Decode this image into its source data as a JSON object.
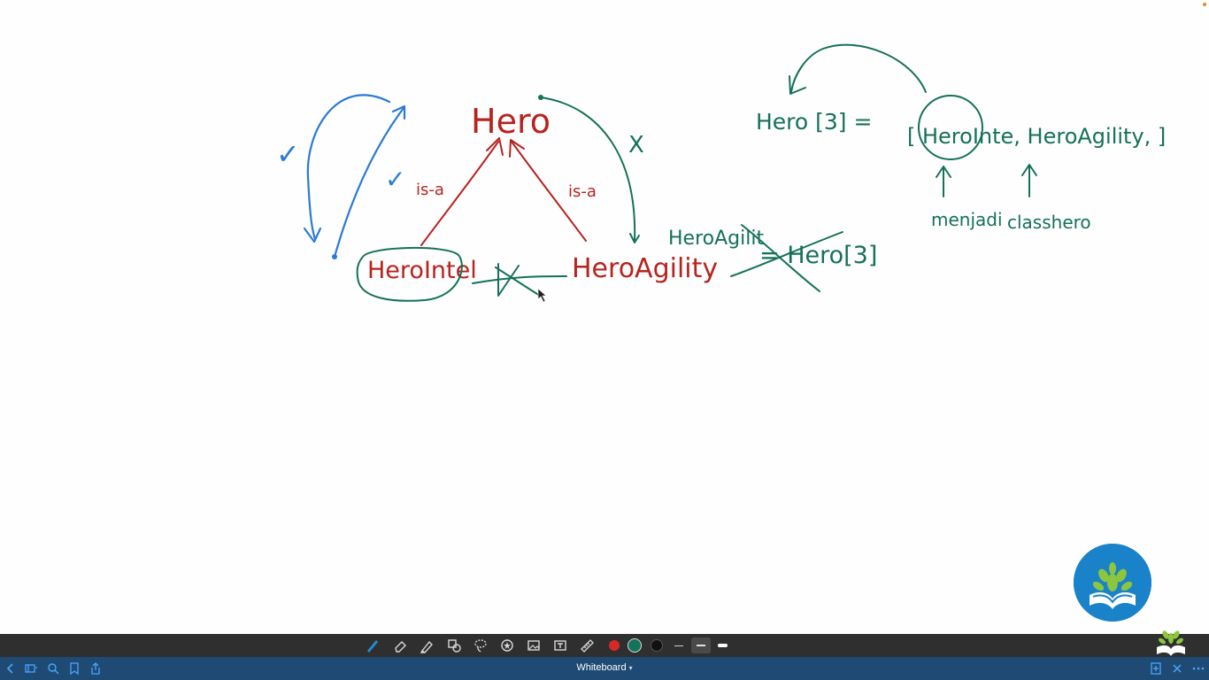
{
  "app": {
    "title": "Whiteboard"
  },
  "canvas": {
    "ink_colors": {
      "red": "#b8231f",
      "green": "#14715a",
      "blue": "#2a7ad6"
    },
    "labels": {
      "hero": "Hero",
      "hero_intel": "HeroIntel",
      "hero_agility": "HeroAgility",
      "is_a_left": "is-a",
      "is_a_right": "is-a",
      "check_outer": "✓",
      "check_inner": "✓",
      "cross_mark": "X",
      "assign_bad_left": "HeroAgilit",
      "assign_bad_right": "= Hero[3]",
      "array_decl": "Hero [3] =",
      "array_items": "[ HeroInte, HeroAgility, ]",
      "annotation_left": "menjadi",
      "annotation_right": "classhero"
    }
  },
  "toolbar": {
    "tools": [
      {
        "name": "pen-tool",
        "icon": "pen-icon"
      },
      {
        "name": "eraser-tool",
        "icon": "eraser-icon"
      },
      {
        "name": "highlighter-tool",
        "icon": "highlighter-icon"
      },
      {
        "name": "shapes-tool",
        "icon": "shapes-icon"
      },
      {
        "name": "lasso-tool",
        "icon": "lasso-icon"
      },
      {
        "name": "sticker-tool",
        "icon": "sticker-icon"
      },
      {
        "name": "image-tool",
        "icon": "image-icon"
      },
      {
        "name": "text-tool",
        "icon": "text-icon"
      },
      {
        "name": "ruler-tool",
        "icon": "ruler-icon"
      }
    ],
    "colors": [
      "#d62828",
      "#14715a",
      "#111111"
    ],
    "selected_color": "#14715a"
  },
  "bottombar": {
    "title": "Whiteboard",
    "accent": "#1f4a74"
  },
  "logo": {
    "badge_color": "#1a82c8",
    "leaf_color": "#8cc63f"
  }
}
